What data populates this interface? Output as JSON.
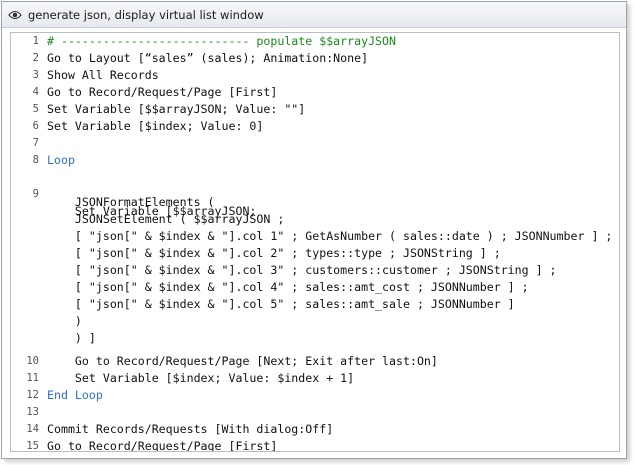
{
  "window": {
    "title": "generate json, display virtual list window",
    "title_icon": "eye-icon"
  },
  "script": {
    "lines": [
      {
        "n": "1",
        "text": "# --------------------------- populate $$arrayJSON",
        "style": "comment"
      },
      {
        "n": "2",
        "text": "Go to Layout [“sales” (sales); Animation:None]",
        "style": "normal"
      },
      {
        "n": "3",
        "text": "Show All Records",
        "style": "normal"
      },
      {
        "n": "4",
        "text": "Go to Record/Request/Page [First]",
        "style": "normal"
      },
      {
        "n": "5",
        "text": "Set Variable [$$arrayJSON; Value: \"\"]",
        "style": "normal"
      },
      {
        "n": "6",
        "text": "Set Variable [$index; Value: 0]",
        "style": "normal"
      },
      {
        "n": "7",
        "text": "",
        "style": "normal"
      },
      {
        "n": "8",
        "text": "Loop",
        "style": "keyword"
      }
    ],
    "line9": {
      "n": "9",
      "text": "    Set Variable [$$arrayJSON;",
      "calc": [
        "    JSONFormatElements (",
        "    JSONSetElement ( $$arrayJSON ;",
        "    [ \"json[\" & $index & \"].col 1\" ; GetAsNumber ( sales::date ) ; JSONNumber ] ;",
        "    [ \"json[\" & $index & \"].col 2\" ; types::type ; JSONString ] ;",
        "    [ \"json[\" & $index & \"].col 3\" ; customers::customer ; JSONString ] ;",
        "    [ \"json[\" & $index & \"].col 4\" ; sales::amt_cost ; JSONNumber ] ;",
        "    [ \"json[\" & $index & \"].col 5\" ; sales::amt_sale ; JSONNumber ]",
        "    )",
        "    ) ]"
      ]
    },
    "lines_after": [
      {
        "n": "10",
        "text": "    Go to Record/Request/Page [Next; Exit after last:On]",
        "style": "normal"
      },
      {
        "n": "11",
        "text": "    Set Variable [$index; Value: $index + 1]",
        "style": "normal"
      },
      {
        "n": "12",
        "text": "End Loop",
        "style": "keyword"
      },
      {
        "n": "13",
        "text": "",
        "style": "normal"
      },
      {
        "n": "14",
        "text": "Commit Records/Requests [With dialog:Off]",
        "style": "normal"
      },
      {
        "n": "15",
        "text": "Go to Record/Request/Page [First]",
        "style": "normal"
      },
      {
        "n": "16",
        "text": "",
        "style": "normal"
      }
    ],
    "colors": {
      "comment": "#1c8a1c",
      "keyword": "#2f6fd0",
      "text": "#111111"
    }
  }
}
